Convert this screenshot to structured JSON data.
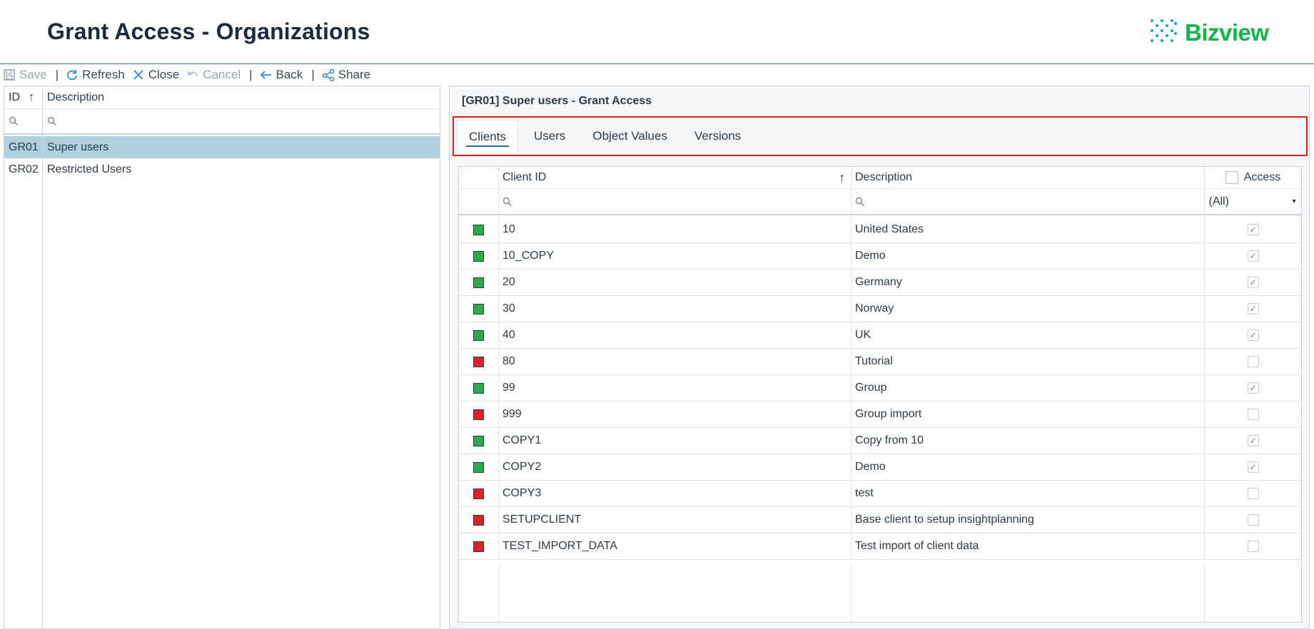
{
  "header": {
    "title": "Grant Access - Organizations",
    "logo_text": "Bizview",
    "logo_color": "#15b34a"
  },
  "toolbar": {
    "save": "Save",
    "refresh": "Refresh",
    "close": "Close",
    "cancel": "Cancel",
    "back": "Back",
    "share": "Share",
    "sep": "|"
  },
  "left_grid": {
    "col_id": "ID",
    "col_desc": "Description",
    "sort_indicator": "↑",
    "rows": [
      {
        "id": "GR01",
        "desc": "Super users",
        "selected": true
      },
      {
        "id": "GR02",
        "desc": "Restricted Users",
        "selected": false
      }
    ]
  },
  "detail": {
    "title": "[GR01] Super users - Grant Access",
    "tabs": [
      {
        "label": "Clients",
        "active": true
      },
      {
        "label": "Users",
        "active": false
      },
      {
        "label": "Object Values",
        "active": false
      },
      {
        "label": "Versions",
        "active": false
      }
    ]
  },
  "client_grid": {
    "col_client_id": "Client ID",
    "col_description": "Description",
    "col_access": "Access",
    "sort_indicator": "↑",
    "access_filter": "(All)",
    "rows": [
      {
        "client_id": "10",
        "description": "United States",
        "status": "green",
        "access": true
      },
      {
        "client_id": "10_COPY",
        "description": "Demo",
        "status": "green",
        "access": true
      },
      {
        "client_id": "20",
        "description": "Germany",
        "status": "green",
        "access": true
      },
      {
        "client_id": "30",
        "description": "Norway",
        "status": "green",
        "access": true
      },
      {
        "client_id": "40",
        "description": "UK",
        "status": "green",
        "access": true
      },
      {
        "client_id": "80",
        "description": "Tutorial",
        "status": "red",
        "access": false
      },
      {
        "client_id": "99",
        "description": "Group",
        "status": "green",
        "access": true
      },
      {
        "client_id": "999",
        "description": "Group import",
        "status": "red",
        "access": false
      },
      {
        "client_id": "COPY1",
        "description": "Copy from 10",
        "status": "green",
        "access": true
      },
      {
        "client_id": "COPY2",
        "description": "Demo",
        "status": "green",
        "access": true
      },
      {
        "client_id": "COPY3",
        "description": "test",
        "status": "red",
        "access": false
      },
      {
        "client_id": "SETUPCLIENT",
        "description": "Base client to setup insightplanning",
        "status": "red",
        "access": false
      },
      {
        "client_id": "TEST_IMPORT_DATA",
        "description": "Test import of client data",
        "status": "red",
        "access": false
      }
    ]
  },
  "colors": {
    "status_green": "#2fa84f",
    "status_red": "#d6262b",
    "selection": "#b1d0dd",
    "highlight_border": "#e01e1e"
  }
}
